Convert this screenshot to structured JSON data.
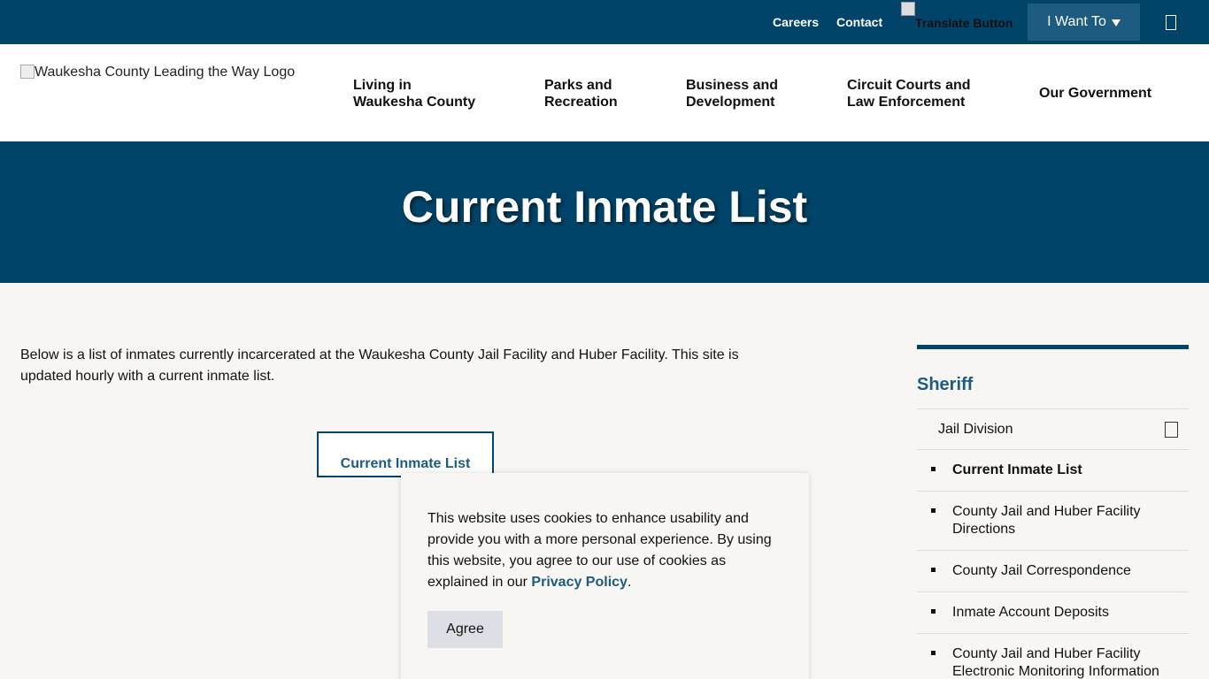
{
  "topbar": {
    "careers": "Careers",
    "contact": "Contact",
    "translate_alt": "Translate Button",
    "i_want_to": "I Want To"
  },
  "header": {
    "logo_alt": "Waukesha County Leading the Way Logo",
    "nav": [
      {
        "line1": "Living in",
        "line2": "Waukesha County"
      },
      {
        "line1": "Parks and",
        "line2": "Recreation"
      },
      {
        "line1": "Business and",
        "line2": "Development"
      },
      {
        "line1": "Circuit Courts and",
        "line2": "Law Enforcement"
      },
      {
        "line1": "Our Government",
        "line2": ""
      }
    ]
  },
  "hero": {
    "title": "Current Inmate List"
  },
  "main": {
    "intro": "Below is a list of inmates currently incarcerated at the Waukesha County Jail Facility and Huber Facility. This site is updated hourly with a current inmate list.",
    "cta_label": "Current Inmate List"
  },
  "cookie": {
    "text": "This website uses cookies to enhance usability and provide you with a more personal experience. By using this website, you agree to our use of cookies as explained in our ",
    "link": "Privacy Policy",
    "period": ".",
    "agree": "Agree"
  },
  "sidebar": {
    "heading": "Sheriff",
    "parent": "Jail Division",
    "items": [
      {
        "label": "Current Inmate List",
        "active": true
      },
      {
        "label": "County Jail and Huber Facility Directions"
      },
      {
        "label": "County Jail Correspondence"
      },
      {
        "label": "Inmate Account Deposits"
      },
      {
        "label": "County Jail and Huber Facility Electronic Monitoring Information Rulebooks"
      }
    ]
  },
  "colors": {
    "navy": "#004469",
    "link_blue": "#1d5b80",
    "background": "#f8f6f2"
  }
}
